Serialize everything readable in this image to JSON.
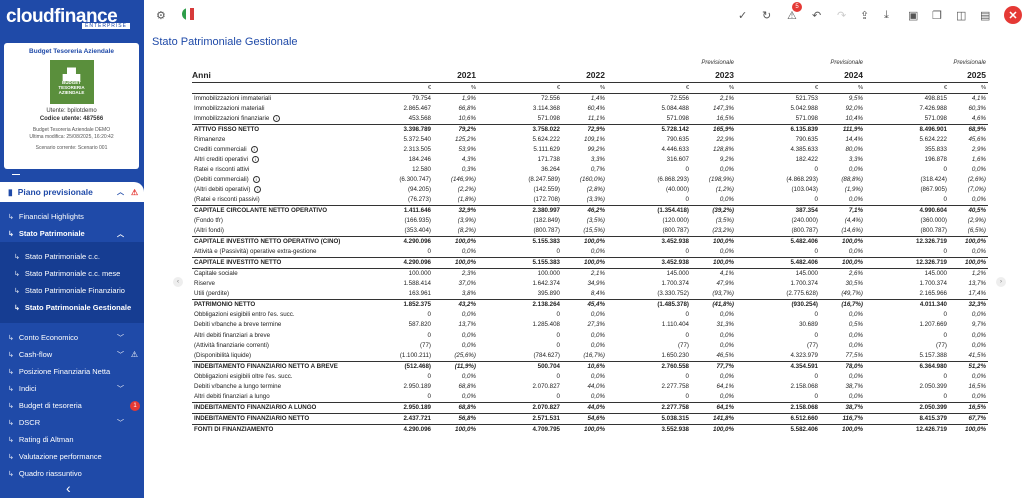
{
  "app": {
    "logo": "cloudfinance",
    "edition": "ENTERPRISE"
  },
  "user_card": {
    "title": "Budget Tesoreria Aziendale",
    "thumb_text": "BUDGET TESORERIA AZIENDALE",
    "user": "Utente: bpilotdemo",
    "code": "Codice utente: 487566",
    "project": "Budget Tesoreria Aziendale DEMO",
    "modified": "Ultima modifica: 25/08/2025, 16:20:42",
    "scenario": "Scenario corrente: Scenario 001"
  },
  "nav": {
    "top": "Piano previsionale",
    "items": [
      {
        "label": "Financial Highlights"
      },
      {
        "label": "Stato Patrimoniale"
      },
      {
        "label": "Stato Patrimoniale c.c."
      },
      {
        "label": "Stato Patrimoniale c.c. mese"
      },
      {
        "label": "Stato Patrimoniale Finanziario"
      },
      {
        "label": "Stato Patrimoniale Gestionale"
      },
      {
        "label": "Conto Economico"
      },
      {
        "label": "Cash-flow"
      },
      {
        "label": "Posizione Finanziaria Netta"
      },
      {
        "label": "Indici"
      },
      {
        "label": "Budget di tesoreria",
        "badge": "1"
      },
      {
        "label": "DSCR"
      },
      {
        "label": "Rating di Altman"
      },
      {
        "label": "Valutazione performance"
      },
      {
        "label": "Quadro riassuntivo"
      }
    ]
  },
  "toolbar": {
    "alert_count": "5"
  },
  "page_title": "Stato Patrimoniale Gestionale",
  "table": {
    "first_header": "Anni",
    "previsionale": "Previsionale",
    "years": [
      "2021",
      "2022",
      "2023",
      "2024",
      "2025"
    ],
    "unit_value": "€",
    "unit_pct": "%",
    "rows": [
      {
        "label": "Immobilizzazioni immateriali",
        "vals": [
          "79.754",
          "1,9%",
          "72.556",
          "1,4%",
          "72.556",
          "2,1%",
          "521.753",
          "9,5%",
          "498.815",
          "4,1%"
        ]
      },
      {
        "label": "Immobilizzazioni materiali",
        "vals": [
          "2.865.467",
          "66,8%",
          "3.114.368",
          "60,4%",
          "5.084.488",
          "147,3%",
          "5.042.988",
          "92,0%",
          "7.426.988",
          "60,3%"
        ]
      },
      {
        "label": "Immobilizzazioni finanziarie",
        "info": true,
        "vals": [
          "453.568",
          "10,6%",
          "571.098",
          "11,1%",
          "571.098",
          "16,5%",
          "571.098",
          "10,4%",
          "571.098",
          "4,6%"
        ]
      },
      {
        "label": "ATTIVO FISSO NETTO",
        "bold": true,
        "bt": true,
        "vals": [
          "3.398.789",
          "79,2%",
          "3.758.022",
          "72,9%",
          "5.728.142",
          "165,9%",
          "6.135.839",
          "111,9%",
          "8.496.901",
          "68,9%"
        ]
      },
      {
        "label": "Rimanenze",
        "vals": [
          "5.372.540",
          "125,2%",
          "5.624.222",
          "109,1%",
          "790.635",
          "22,9%",
          "790.635",
          "14,4%",
          "5.624.222",
          "45,6%"
        ]
      },
      {
        "label": "Crediti commerciali",
        "info": true,
        "vals": [
          "2.313.505",
          "53,9%",
          "5.111.629",
          "99,2%",
          "4.446.633",
          "128,8%",
          "4.385.633",
          "80,0%",
          "355.833",
          "2,9%"
        ]
      },
      {
        "label": "Altri crediti operativi",
        "info": true,
        "vals": [
          "184.246",
          "4,3%",
          "171.738",
          "3,3%",
          "316.607",
          "9,2%",
          "182.422",
          "3,3%",
          "196.878",
          "1,6%"
        ]
      },
      {
        "label": "Ratei e risconti attivi",
        "vals": [
          "12.580",
          "0,3%",
          "36.264",
          "0,7%",
          "0",
          "0,0%",
          "0",
          "0,0%",
          "0",
          "0,0%"
        ]
      },
      {
        "label": "(Debiti commerciali)",
        "info": true,
        "vals": [
          "(6.300.747)",
          "(146,9%)",
          "(8.247.589)",
          "(160,0%)",
          "(6.868.293)",
          "(198,9%)",
          "(4.868.293)",
          "(88,8%)",
          "(318.424)",
          "(2,6%)"
        ]
      },
      {
        "label": "(Altri debiti operativi)",
        "info": true,
        "vals": [
          "(94.205)",
          "(2,2%)",
          "(142.559)",
          "(2,8%)",
          "(40.000)",
          "(1,2%)",
          "(103.043)",
          "(1,9%)",
          "(867.905)",
          "(7,0%)"
        ]
      },
      {
        "label": "(Ratei e risconti passivi)",
        "vals": [
          "(76.273)",
          "(1,8%)",
          "(172.708)",
          "(3,3%)",
          "0",
          "0,0%",
          "0",
          "0,0%",
          "0",
          "0,0%"
        ]
      },
      {
        "label": "CAPITALE CIRCOLANTE NETTO OPERATIVO",
        "bold": true,
        "bt": true,
        "vals": [
          "1.411.646",
          "32,9%",
          "2.380.997",
          "46,2%",
          "(1.354.418)",
          "(39,2%)",
          "387.354",
          "7,1%",
          "4.990.604",
          "40,5%"
        ]
      },
      {
        "label": "(Fondo tfr)",
        "vals": [
          "(166.935)",
          "(3,9%)",
          "(182.849)",
          "(3,5%)",
          "(120.000)",
          "(3,5%)",
          "(240.000)",
          "(4,4%)",
          "(360.000)",
          "(2,9%)"
        ]
      },
      {
        "label": "(Altri fondi)",
        "vals": [
          "(353.404)",
          "(8,2%)",
          "(800.787)",
          "(15,5%)",
          "(800.787)",
          "(23,2%)",
          "(800.787)",
          "(14,6%)",
          "(800.787)",
          "(6,5%)"
        ]
      },
      {
        "label": "CAPITALE INVESTITO NETTO OPERATIVO (CINO)",
        "bold": true,
        "bt": true,
        "vals": [
          "4.290.096",
          "100,0%",
          "5.155.383",
          "100,0%",
          "3.452.938",
          "100,0%",
          "5.482.406",
          "100,0%",
          "12.326.719",
          "100,0%"
        ]
      },
      {
        "label": "Attività e (Passività) operative extra-gestione",
        "vals": [
          "0",
          "0,0%",
          "0",
          "0,0%",
          "0",
          "0,0%",
          "0",
          "0,0%",
          "0",
          "0,0%"
        ]
      },
      {
        "label": "CAPITALE INVESTITO NETTO",
        "bold": true,
        "bt": true,
        "vals": [
          "4.290.096",
          "100,0%",
          "5.155.383",
          "100,0%",
          "3.452.938",
          "100,0%",
          "5.482.406",
          "100,0%",
          "12.326.719",
          "100,0%"
        ]
      },
      {
        "label": "Capitale sociale",
        "bt": true,
        "vals": [
          "100.000",
          "2,3%",
          "100.000",
          "2,1%",
          "145.000",
          "4,1%",
          "145.000",
          "2,6%",
          "145.000",
          "1,2%"
        ]
      },
      {
        "label": "Riserve",
        "vals": [
          "1.588.414",
          "37,0%",
          "1.642.374",
          "34,9%",
          "1.700.374",
          "47,9%",
          "1.700.374",
          "30,5%",
          "1.700.374",
          "13,7%"
        ]
      },
      {
        "label": "Utili (perdite)",
        "vals": [
          "163.961",
          "3,8%",
          "395.890",
          "8,4%",
          "(3.330.752)",
          "(93,7%)",
          "(2.775.628)",
          "(49,7%)",
          "2.165.966",
          "17,4%"
        ]
      },
      {
        "label": "PATRIMONIO NETTO",
        "bold": true,
        "bt": true,
        "vals": [
          "1.852.375",
          "43,2%",
          "2.138.264",
          "45,4%",
          "(1.485.378)",
          "(41,8%)",
          "(930.254)",
          "(16,7%)",
          "4.011.340",
          "32,3%"
        ]
      },
      {
        "label": "Obbligazioni esigibili entro l'es. succ.",
        "vals": [
          "0",
          "0,0%",
          "0",
          "0,0%",
          "0",
          "0,0%",
          "0",
          "0,0%",
          "0",
          "0,0%"
        ]
      },
      {
        "label": "Debiti v/banche a breve termine",
        "vals": [
          "587.820",
          "13,7%",
          "1.285.408",
          "27,3%",
          "1.110.404",
          "31,3%",
          "30.689",
          "0,5%",
          "1.207.669",
          "9,7%"
        ]
      },
      {
        "label": "Altri debiti finanziari a breve",
        "vals": [
          "0",
          "0,0%",
          "0",
          "0,0%",
          "0",
          "0,0%",
          "0",
          "0,0%",
          "0",
          "0,0%"
        ]
      },
      {
        "label": "(Attività finanziarie correnti)",
        "vals": [
          "(77)",
          "0,0%",
          "0",
          "0,0%",
          "(77)",
          "0,0%",
          "(77)",
          "0,0%",
          "(77)",
          "0,0%"
        ]
      },
      {
        "label": "(Disponibilità liquide)",
        "vals": [
          "(1.100.211)",
          "(25,6%)",
          "(784.627)",
          "(16,7%)",
          "1.650.230",
          "46,5%",
          "4.323.979",
          "77,5%",
          "5.157.388",
          "41,5%"
        ]
      },
      {
        "label": "INDEBITAMENTO FINANZIARIO NETTO A BREVE",
        "bold": true,
        "bt": true,
        "vals": [
          "(512.468)",
          "(11,9%)",
          "500.704",
          "10,6%",
          "2.760.558",
          "77,7%",
          "4.354.591",
          "78,0%",
          "6.364.980",
          "51,2%"
        ]
      },
      {
        "label": "Obbligazioni esigibili oltre l'es. succ.",
        "vals": [
          "0",
          "0,0%",
          "0",
          "0,0%",
          "0",
          "0,0%",
          "0",
          "0,0%",
          "0",
          "0,0%"
        ]
      },
      {
        "label": "Debiti v/banche a lungo termine",
        "vals": [
          "2.950.189",
          "68,8%",
          "2.070.827",
          "44,0%",
          "2.277.758",
          "64,1%",
          "2.158.068",
          "38,7%",
          "2.050.399",
          "16,5%"
        ]
      },
      {
        "label": "Altri debiti finanziari a lungo",
        "vals": [
          "0",
          "0,0%",
          "0",
          "0,0%",
          "0",
          "0,0%",
          "0",
          "0,0%",
          "0",
          "0,0%"
        ]
      },
      {
        "label": "INDEBITAMENTO FINANZIARIO A LUNGO",
        "bold": true,
        "bt": true,
        "vals": [
          "2.950.189",
          "68,8%",
          "2.070.827",
          "44,0%",
          "2.277.758",
          "64,1%",
          "2.158.068",
          "38,7%",
          "2.050.399",
          "16,5%"
        ]
      },
      {
        "label": "INDEBITAMENTO FINANZIARIO NETTO",
        "bold": true,
        "bt": true,
        "vals": [
          "2.437.721",
          "56,8%",
          "2.571.531",
          "54,6%",
          "5.038.315",
          "141,8%",
          "6.512.660",
          "116,7%",
          "8.415.379",
          "67,7%"
        ]
      },
      {
        "label": "FONTI DI FINANZIAMENTO",
        "bold": true,
        "bt": true,
        "vals": [
          "4.290.096",
          "100,0%",
          "4.709.795",
          "100,0%",
          "3.552.938",
          "100,0%",
          "5.582.406",
          "100,0%",
          "12.426.719",
          "100,0%"
        ]
      }
    ]
  }
}
